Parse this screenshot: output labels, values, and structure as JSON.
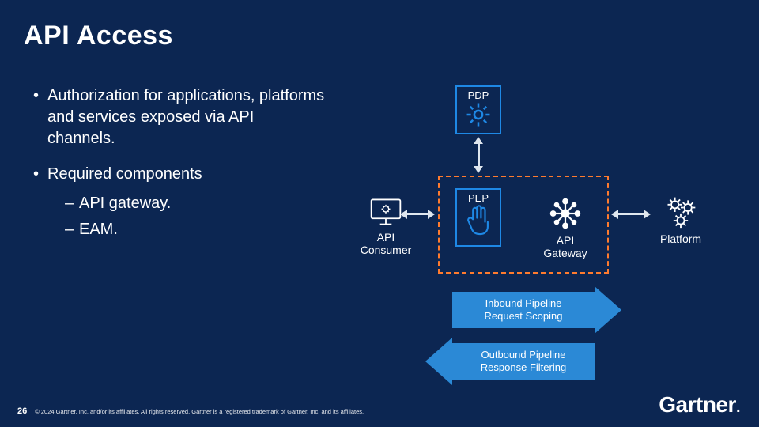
{
  "title": "API Access",
  "bullets": {
    "b1": "Authorization for applications, platforms and services exposed via API channels.",
    "b2": "Required components",
    "sub1": "API gateway.",
    "sub2": "EAM."
  },
  "diagram": {
    "pdp": "PDP",
    "pep": "PEP",
    "consumer": "API Consumer",
    "gateway": "API Gateway",
    "platform": "Platform",
    "inbound_l1": "Inbound Pipeline",
    "inbound_l2": "Request Scoping",
    "outbound_l1": "Outbound Pipeline",
    "outbound_l2": "Response Filtering"
  },
  "footer": {
    "page": "26",
    "copyright": "© 2024 Gartner, Inc. and/or its affiliates. All rights reserved. Gartner is a registered trademark of Gartner, Inc. and its affiliates."
  },
  "logo": "Gartner"
}
